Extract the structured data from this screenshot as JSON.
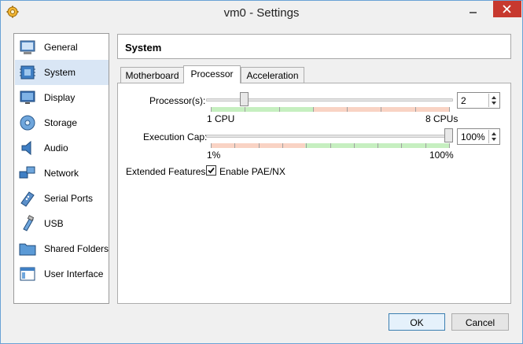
{
  "window": {
    "title": "vm0 - Settings"
  },
  "sidebar": {
    "items": [
      {
        "label": "General",
        "icon": "general-icon"
      },
      {
        "label": "System",
        "icon": "system-icon",
        "selected": true
      },
      {
        "label": "Display",
        "icon": "display-icon"
      },
      {
        "label": "Storage",
        "icon": "storage-icon"
      },
      {
        "label": "Audio",
        "icon": "audio-icon"
      },
      {
        "label": "Network",
        "icon": "network-icon"
      },
      {
        "label": "Serial Ports",
        "icon": "serial-ports-icon"
      },
      {
        "label": "USB",
        "icon": "usb-icon"
      },
      {
        "label": "Shared Folders",
        "icon": "shared-folders-icon"
      },
      {
        "label": "User Interface",
        "icon": "user-interface-icon"
      }
    ]
  },
  "content": {
    "title": "System",
    "tabs": [
      {
        "label": "Motherboard"
      },
      {
        "label": "Processor",
        "active": true
      },
      {
        "label": "Acceleration"
      }
    ]
  },
  "processor": {
    "processors_label": "Processor(s):",
    "processors_value": "2",
    "processors_min_label": "1 CPU",
    "processors_max_label": "8 CPUs",
    "processors_count": 2,
    "processors_min": 1,
    "processors_max": 8,
    "exec_cap_label": "Execution Cap:",
    "exec_cap_value": "100%",
    "exec_cap_min_label": "1%",
    "exec_cap_max_label": "100%",
    "exec_cap_percent": 100,
    "extended_label": "Extended Features:",
    "pae_label": "Enable PAE/NX",
    "pae_checked": true
  },
  "buttons": {
    "ok": "OK",
    "cancel": "Cancel"
  },
  "colors": {
    "good_range": "#c6efc0",
    "warn_range": "#f9d3c4",
    "selection": "#d9e6f5",
    "close_button": "#c7392f"
  }
}
